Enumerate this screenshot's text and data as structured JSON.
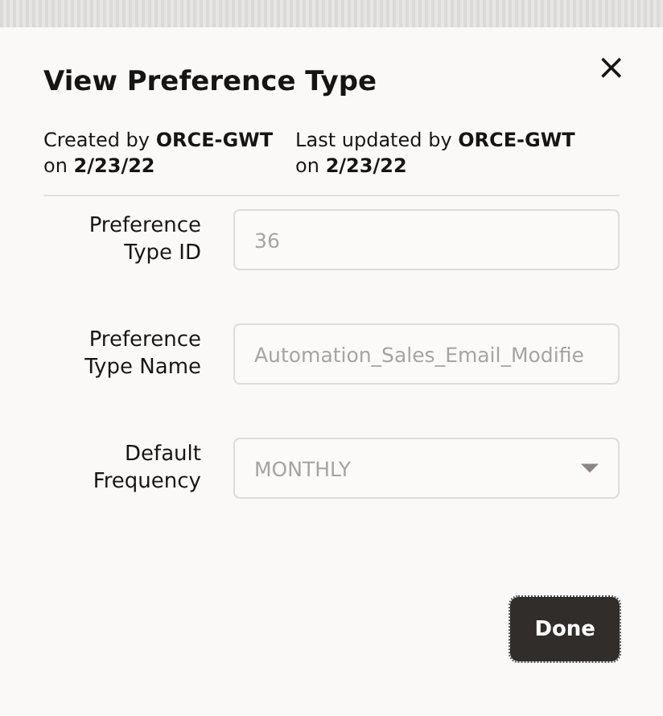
{
  "dialog": {
    "title": "View Preference Type",
    "close": "×",
    "meta": [
      "Created by **ORCE-GWT**\non **2/23/22**",
      "Last updated by **ORCE-GWT**\non **2/23/22**"
    ],
    "fields": [
      {
        "label": "Preference Type ID",
        "kind": "text",
        "value": "36",
        "disabled": true
      },
      {
        "label": "Preference Type Name",
        "kind": "text",
        "value": "Automation_Sales_Email_Modifie",
        "disabled": true
      },
      {
        "label": "Default Frequency",
        "kind": "select",
        "value": "MONTHLY",
        "disabled": true
      }
    ],
    "buttons": [
      {
        "label": "Done",
        "focused": true
      }
    ]
  }
}
